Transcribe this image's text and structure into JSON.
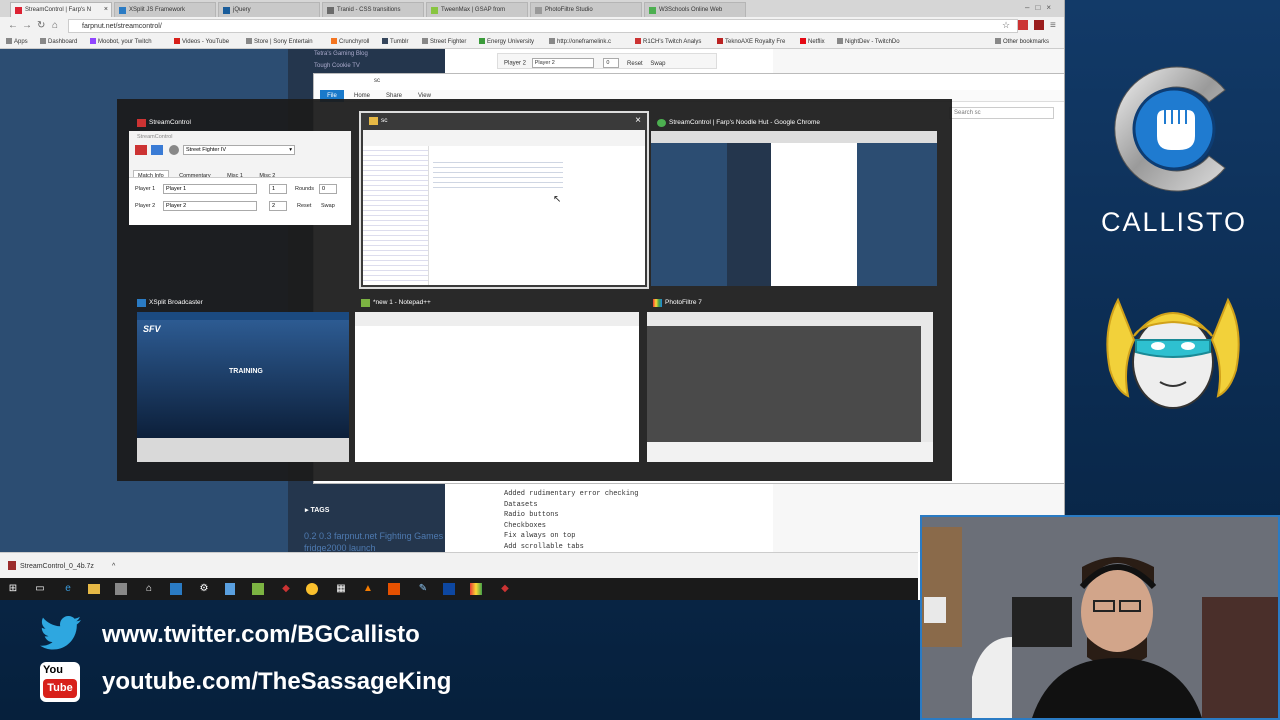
{
  "browser": {
    "tabs": [
      {
        "label": "StreamControl | Farp's N"
      },
      {
        "label": "XSplit JS Framework"
      },
      {
        "label": "jQuery"
      },
      {
        "label": "Tranid - CSS transitions"
      },
      {
        "label": "TweenMax | GSAP from"
      },
      {
        "label": "PhotoFiltre Studio"
      },
      {
        "label": "W3Schools Online Web"
      }
    ],
    "url": "farpnut.net/streamcontrol/",
    "bookmarks": [
      {
        "label": "Apps"
      },
      {
        "label": "Dashboard"
      },
      {
        "label": "Moobot, your Twitch"
      },
      {
        "label": "Videos - YouTube"
      },
      {
        "label": "Store | Sony Entertain"
      },
      {
        "label": "Crunchyroll"
      },
      {
        "label": "Tumblr"
      },
      {
        "label": "Street Fighter"
      },
      {
        "label": "Energy University"
      },
      {
        "label": "http://oneframelink.c"
      },
      {
        "label": "R1CH's Twitch Analys"
      },
      {
        "label": "TeknoAXE Royalty Fre"
      },
      {
        "label": "Netflix"
      },
      {
        "label": "NightDev - TwitchDo"
      }
    ],
    "other_bookmarks": "Other bookmarks"
  },
  "page": {
    "blog_links": [
      "Tetra's Gaming Blog",
      "Tough Cookie TV"
    ],
    "player_row": {
      "label": "Player 2",
      "value": "Player 2",
      "count": "0",
      "reset": "Reset",
      "swap": "Swap"
    },
    "explorer_ribbon": [
      "File",
      "Home",
      "Share",
      "View"
    ],
    "explorer_title": "sc",
    "search_placeholder": "Search sc",
    "changelog": [
      "Added rudimentary error checking",
      "Datasets",
      "Radio buttons",
      "Checkboxes",
      "Fix always on top",
      "Add scrollable tabs"
    ],
    "tags_heading": "TAGS",
    "tags_text": "0.2 0.3 farpnut.net Fighting Games fridge2000 launch"
  },
  "switcher": {
    "windows": [
      {
        "title": "StreamControl"
      },
      {
        "title": "sc"
      },
      {
        "title": "StreamControl | Farp's Noodle Hut - Google Chrome"
      },
      {
        "title": "XSplit Broadcaster"
      },
      {
        "title": "*new 1 - Notepad++"
      },
      {
        "title": "PhotoFiltre 7"
      }
    ],
    "streamcontrol": {
      "inner_title": "StreamControl",
      "game": "Street Fighter IV",
      "tabs": [
        "Match Info",
        "Commentary",
        "Misc 1",
        "Misc 2"
      ],
      "player1_label": "Player 1",
      "player1_value": "Player 1",
      "player1_score": "1",
      "rounds_label": "Rounds",
      "rounds_value": "0",
      "player2_label": "Player 2",
      "player2_value": "Player 2",
      "player2_score": "2",
      "reset": "Reset",
      "swap": "Swap"
    },
    "xsplit": {
      "game_logo": "SFV",
      "mode": "TRAINING"
    }
  },
  "downloads": {
    "file": "StreamControl_0_4b.7z"
  },
  "overlay": {
    "twitter": "www.twitter.com/BGCallisto",
    "youtube": "youtube.com/TheSassageKing",
    "youtube_icon_top": "You",
    "youtube_icon_bottom": "Tube",
    "brand": "CALLISTO"
  },
  "colors": {
    "overlay_blue": "#0c2e54",
    "webcam_border": "#2a7bc4",
    "accent_blue": "#1f7bd0",
    "youtube_red": "#d8201a"
  }
}
